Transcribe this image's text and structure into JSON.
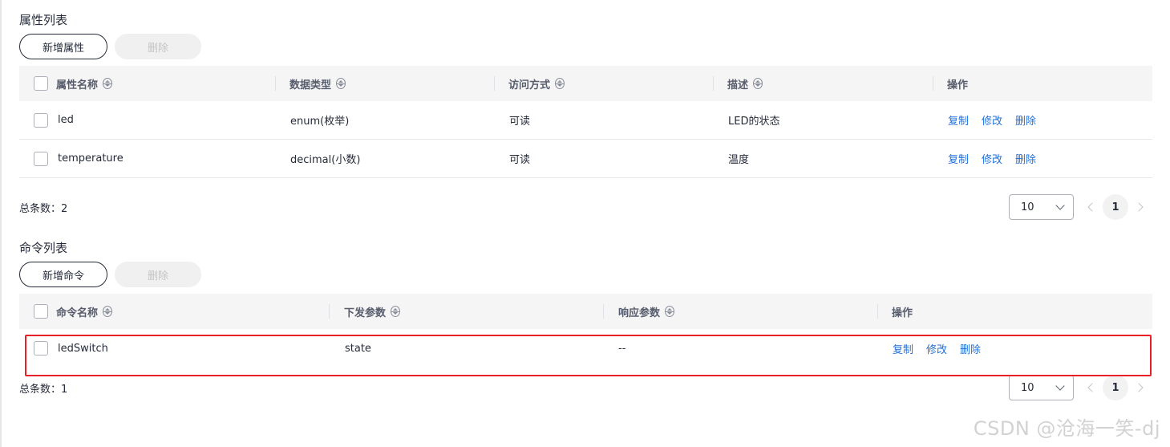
{
  "properties": {
    "title": "属性列表",
    "add_label": "新增属性",
    "delete_label": "删除",
    "columns": [
      "属性名称",
      "数据类型",
      "访问方式",
      "描述",
      "操作"
    ],
    "rows": [
      {
        "name": "led",
        "type": "enum(枚举)",
        "access": "可读",
        "desc": "LED的状态"
      },
      {
        "name": "temperature",
        "type": "decimal(小数)",
        "access": "可读",
        "desc": "温度"
      }
    ],
    "actions": {
      "copy": "复制",
      "edit": "修改",
      "delete": "删除"
    },
    "total": "总条数：2",
    "page_size": "10",
    "page": "1"
  },
  "commands": {
    "title": "命令列表",
    "add_label": "新增命令",
    "delete_label": "删除",
    "columns": [
      "命令名称",
      "下发参数",
      "响应参数",
      "操作"
    ],
    "rows": [
      {
        "name": "ledSwitch",
        "params": "state",
        "response": "--"
      }
    ],
    "actions": {
      "copy": "复制",
      "edit": "修改",
      "delete": "删除"
    },
    "total": "总条数：1",
    "page_size": "10",
    "page": "1"
  },
  "watermark": "CSDN @沧海一笑-dj",
  "colors": {
    "link": "#1e6fd9",
    "highlight": "#e8202a",
    "header_bg": "#f5f5f6"
  }
}
